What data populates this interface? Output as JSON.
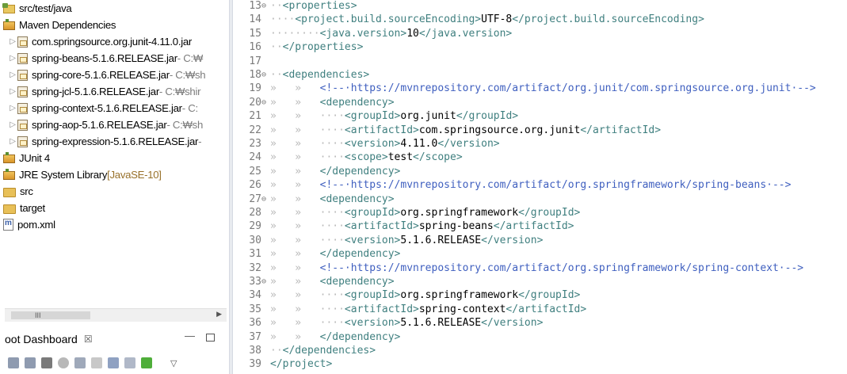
{
  "explorer": {
    "items": [
      {
        "label": "src/test/java",
        "suffix": "",
        "icon": "source-folder-icon",
        "indent": 12,
        "arrow": ""
      },
      {
        "label": "Maven Dependencies",
        "suffix": "",
        "icon": "library-icon",
        "indent": 12,
        "arrow": ""
      },
      {
        "label": "com.springsource.org.junit-4.11.0.jar",
        "suffix": "",
        "icon": "jar-icon",
        "indent": 18,
        "arrow": "▷"
      },
      {
        "label": "spring-beans-5.1.6.RELEASE.jar",
        "suffix": " - C:₩",
        "icon": "jar-icon",
        "indent": 18,
        "arrow": "▷"
      },
      {
        "label": "spring-core-5.1.6.RELEASE.jar",
        "suffix": " - C:₩sh",
        "icon": "jar-icon",
        "indent": 18,
        "arrow": "▷"
      },
      {
        "label": "spring-jcl-5.1.6.RELEASE.jar",
        "suffix": " - C:₩shir",
        "icon": "jar-icon",
        "indent": 18,
        "arrow": "▷"
      },
      {
        "label": "spring-context-5.1.6.RELEASE.jar",
        "suffix": " - C:",
        "icon": "jar-icon",
        "indent": 18,
        "arrow": "▷"
      },
      {
        "label": "spring-aop-5.1.6.RELEASE.jar",
        "suffix": " - C:₩sh",
        "icon": "jar-icon",
        "indent": 18,
        "arrow": "▷"
      },
      {
        "label": "spring-expression-5.1.6.RELEASE.jar",
        "suffix": " -",
        "icon": "jar-icon",
        "indent": 18,
        "arrow": "▷"
      },
      {
        "label": "JUnit 4",
        "suffix": "",
        "icon": "library-icon",
        "indent": 12,
        "arrow": ""
      },
      {
        "label": "JRE System Library",
        "suffix": " [JavaSE-10]",
        "icon": "library-icon",
        "indent": 12,
        "arrow": ""
      },
      {
        "label": "src",
        "suffix": "",
        "icon": "folder-icon",
        "indent": 12,
        "arrow": ""
      },
      {
        "label": "target",
        "suffix": "",
        "icon": "folder-icon",
        "indent": 12,
        "arrow": ""
      },
      {
        "label": "pom.xml",
        "suffix": "",
        "icon": "xml-file-icon",
        "indent": 12,
        "arrow": ""
      }
    ]
  },
  "dashboard": {
    "title": "oot Dashboard",
    "close": "☒",
    "minimize": "—"
  },
  "editor": {
    "lines": [
      {
        "n": "13",
        "fold": "⊖",
        "ws": "··",
        "parts": [
          [
            "tag",
            "<properties>"
          ]
        ]
      },
      {
        "n": "14",
        "fold": "",
        "ws": "····",
        "parts": [
          [
            "tag",
            "<project.build.sourceEncoding>"
          ],
          [
            "txt",
            "UTF-8"
          ],
          [
            "tag",
            "</project.build.sourceEncoding>"
          ]
        ]
      },
      {
        "n": "15",
        "fold": "",
        "ws": "········",
        "parts": [
          [
            "tag",
            "<java.version>"
          ],
          [
            "txt",
            "10"
          ],
          [
            "tag",
            "</java.version>"
          ]
        ]
      },
      {
        "n": "16",
        "fold": "",
        "ws": "··",
        "parts": [
          [
            "tag",
            "</properties>"
          ]
        ]
      },
      {
        "n": "17",
        "fold": "",
        "ws": "",
        "parts": []
      },
      {
        "n": "18",
        "fold": "⊖",
        "ws": "··",
        "parts": [
          [
            "tag",
            "<dependencies>"
          ]
        ]
      },
      {
        "n": "19",
        "fold": "",
        "ws": "»   »   ",
        "parts": [
          [
            "cmt",
            "<!--·https://mvnrepository.com/artifact/org.junit/com.springsource.org.junit·-->"
          ]
        ]
      },
      {
        "n": "20",
        "fold": "⊖",
        "ws": "»   »   ",
        "parts": [
          [
            "tag",
            "<dependency>"
          ]
        ]
      },
      {
        "n": "21",
        "fold": "",
        "ws": "»   »   ····",
        "parts": [
          [
            "tag",
            "<groupId>"
          ],
          [
            "txt",
            "org.junit"
          ],
          [
            "tag",
            "</groupId>"
          ]
        ]
      },
      {
        "n": "22",
        "fold": "",
        "ws": "»   »   ····",
        "parts": [
          [
            "tag",
            "<artifactId>"
          ],
          [
            "txt",
            "com.springsource.org.junit"
          ],
          [
            "tag",
            "</artifactId>"
          ]
        ]
      },
      {
        "n": "23",
        "fold": "",
        "ws": "»   »   ····",
        "parts": [
          [
            "tag",
            "<version>"
          ],
          [
            "txt",
            "4.11.0"
          ],
          [
            "tag",
            "</version>"
          ]
        ]
      },
      {
        "n": "24",
        "fold": "",
        "ws": "»   »   ····",
        "parts": [
          [
            "tag",
            "<scope>"
          ],
          [
            "txt",
            "test"
          ],
          [
            "tag",
            "</scope>"
          ]
        ]
      },
      {
        "n": "25",
        "fold": "",
        "ws": "»   »   ",
        "parts": [
          [
            "tag",
            "</dependency>"
          ]
        ]
      },
      {
        "n": "26",
        "fold": "",
        "ws": "»   »   ",
        "parts": [
          [
            "cmt",
            "<!--·https://mvnrepository.com/artifact/org.springframework/spring-beans·-->"
          ]
        ]
      },
      {
        "n": "27",
        "fold": "⊖",
        "ws": "»   »   ",
        "parts": [
          [
            "tag",
            "<dependency>"
          ]
        ]
      },
      {
        "n": "28",
        "fold": "",
        "ws": "»   »   ····",
        "parts": [
          [
            "tag",
            "<groupId>"
          ],
          [
            "txt",
            "org.springframework"
          ],
          [
            "tag",
            "</groupId>"
          ]
        ]
      },
      {
        "n": "29",
        "fold": "",
        "ws": "»   »   ····",
        "parts": [
          [
            "tag",
            "<artifactId>"
          ],
          [
            "txt",
            "spring-beans"
          ],
          [
            "tag",
            "</artifactId>"
          ]
        ]
      },
      {
        "n": "30",
        "fold": "",
        "ws": "»   »   ····",
        "parts": [
          [
            "tag",
            "<version>"
          ],
          [
            "txt",
            "5.1.6.RELEASE"
          ],
          [
            "tag",
            "</version>"
          ]
        ]
      },
      {
        "n": "31",
        "fold": "",
        "ws": "»   »   ",
        "parts": [
          [
            "tag",
            "</dependency>"
          ]
        ]
      },
      {
        "n": "32",
        "fold": "",
        "ws": "»   »   ",
        "parts": [
          [
            "cmt",
            "<!--·https://mvnrepository.com/artifact/org.springframework/spring-context·-->"
          ]
        ]
      },
      {
        "n": "33",
        "fold": "⊖",
        "ws": "»   »   ",
        "parts": [
          [
            "tag",
            "<dependency>"
          ]
        ]
      },
      {
        "n": "34",
        "fold": "",
        "ws": "»   »   ····",
        "parts": [
          [
            "tag",
            "<groupId>"
          ],
          [
            "txt",
            "org.springframework"
          ],
          [
            "tag",
            "</groupId>"
          ]
        ]
      },
      {
        "n": "35",
        "fold": "",
        "ws": "»   »   ····",
        "parts": [
          [
            "tag",
            "<artifactId>"
          ],
          [
            "txt",
            "spring-context"
          ],
          [
            "tag",
            "</artifactId>"
          ]
        ]
      },
      {
        "n": "36",
        "fold": "",
        "ws": "»   »   ····",
        "parts": [
          [
            "tag",
            "<version>"
          ],
          [
            "txt",
            "5.1.6.RELEASE"
          ],
          [
            "tag",
            "</version>"
          ]
        ]
      },
      {
        "n": "37",
        "fold": "",
        "ws": "»   »   ",
        "parts": [
          [
            "tag",
            "</dependency>"
          ]
        ]
      },
      {
        "n": "38",
        "fold": "",
        "ws": "··",
        "parts": [
          [
            "tag",
            "</dependencies>"
          ]
        ]
      },
      {
        "n": "39",
        "fold": "",
        "ws": "",
        "parts": [
          [
            "tag",
            "</project>"
          ]
        ]
      }
    ]
  },
  "colors": {
    "tag": "#3f7f7f",
    "comment": "#3f5fbf",
    "text": "#000000",
    "line_number": "#7a7a7a"
  }
}
